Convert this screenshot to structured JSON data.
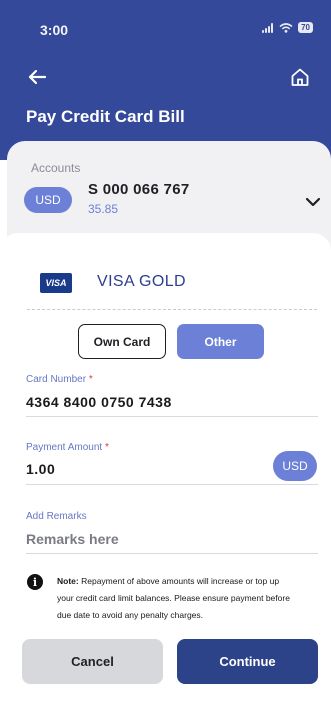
{
  "status_bar": {
    "time": "3:00",
    "battery": "70"
  },
  "header": {
    "title": "Pay Credit Card Bill"
  },
  "accounts": {
    "label": "Accounts",
    "currency": "USD",
    "account_number": "S 000 066 767",
    "balance": "35.85"
  },
  "card": {
    "brand": "VISA",
    "name": "VISA GOLD"
  },
  "toggle": {
    "own_card": "Own Card",
    "other": "Other",
    "selected": "Other"
  },
  "card_number": {
    "label": "Card Number",
    "required_mark": "*",
    "value": "4364 8400 0750 7438"
  },
  "payment_amount": {
    "label": "Payment Amount",
    "required_mark": "*",
    "value": "1.00",
    "currency": "USD"
  },
  "remarks": {
    "label": "Add Remarks",
    "placeholder": "Remarks here"
  },
  "note": {
    "lead": "Note:",
    "text": " Repayment of above amounts will increase or top up your credit card limit balances. Please ensure payment before due date to avoid any penalty charges."
  },
  "actions": {
    "cancel": "Cancel",
    "continue": "Continue"
  },
  "colors": {
    "header": "#34499a",
    "accent": "#6b80d6",
    "primary_button": "#2d4389"
  },
  "icons": [
    "back-arrow-icon",
    "home-icon",
    "chevron-down-icon",
    "info-icon",
    "signal-icon",
    "wifi-icon",
    "battery-icon"
  ]
}
